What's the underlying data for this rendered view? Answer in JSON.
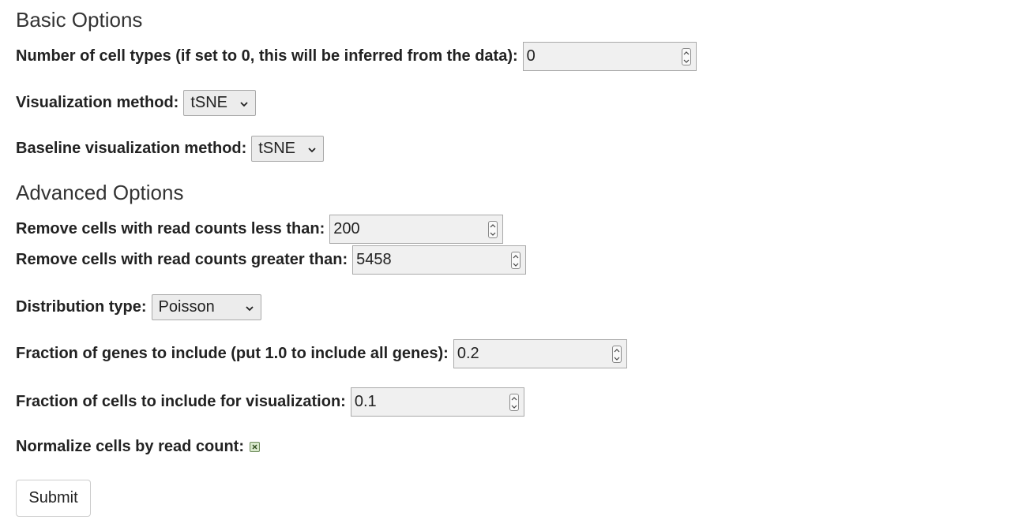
{
  "basic": {
    "heading": "Basic Options",
    "num_cell_types": {
      "label": "Number of cell types (if set to 0, this will be inferred from the data):",
      "value": "0"
    },
    "vis_method": {
      "label": "Visualization method:",
      "selected": "tSNE"
    },
    "baseline_vis_method": {
      "label": "Baseline visualization method:",
      "selected": "tSNE"
    }
  },
  "advanced": {
    "heading": "Advanced Options",
    "min_read_counts": {
      "label": "Remove cells with read counts less than:",
      "value": "200"
    },
    "max_read_counts": {
      "label": "Remove cells with read counts greater than:",
      "value": "5458"
    },
    "distribution": {
      "label": "Distribution type:",
      "selected": "Poisson"
    },
    "gene_fraction": {
      "label": "Fraction of genes to include (put 1.0 to include all genes):",
      "value": "0.2"
    },
    "cell_fraction": {
      "label": "Fraction of cells to include for visualization:",
      "value": "0.1"
    },
    "normalize": {
      "label": "Normalize cells by read count:",
      "checked": true
    }
  },
  "submit_label": "Submit"
}
